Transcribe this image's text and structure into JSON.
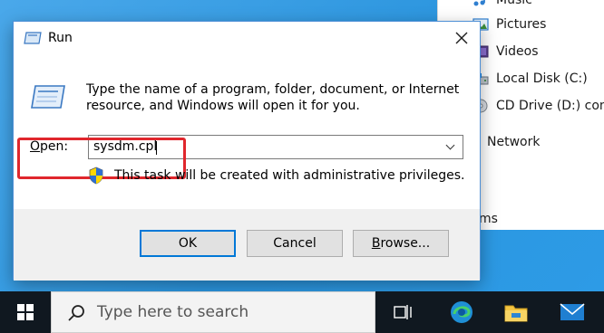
{
  "explorer": {
    "items": [
      {
        "label": "Music",
        "icon": "music-icon"
      },
      {
        "label": "Pictures",
        "icon": "pictures-icon"
      },
      {
        "label": "Videos",
        "icon": "videos-icon"
      },
      {
        "label": "Local Disk (C:)",
        "icon": "local-disk-icon"
      },
      {
        "label": "CD Drive (D:) conf",
        "icon": "cd-drive-icon"
      },
      {
        "label": "Network",
        "icon": "network-icon"
      }
    ],
    "fragment": "ms"
  },
  "run": {
    "title": "Run",
    "description": "Type the name of a program, folder, document, or Internet resource, and Windows will open it for you.",
    "open_label_accel": "O",
    "open_label_rest": "pen:",
    "open_value": "sysdm.cpl",
    "admin_note": "This task will be created with administrative privileges.",
    "buttons": {
      "ok": "OK",
      "cancel": "Cancel",
      "browse_accel": "B",
      "browse_rest": "rowse..."
    }
  },
  "taskbar": {
    "search_placeholder": "Type here to search",
    "icons": [
      "start-icon",
      "task-view-icon",
      "edge-icon",
      "file-explorer-icon",
      "mail-icon"
    ]
  },
  "colors": {
    "highlight": "#e0272d",
    "accent": "#0078d7",
    "desktop": "#2b95de",
    "taskbar": "#101820"
  }
}
